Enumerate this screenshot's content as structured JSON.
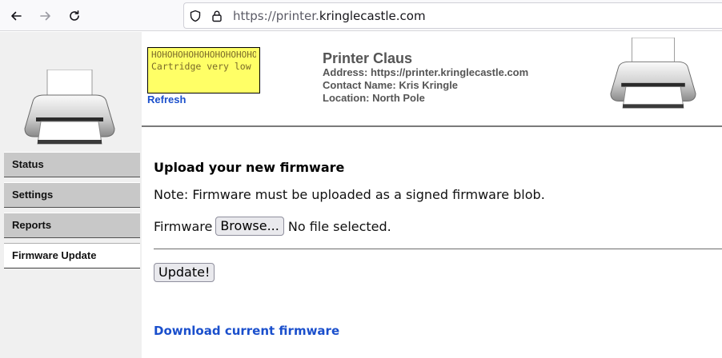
{
  "browser": {
    "url_prefix": "https://printer.",
    "url_domain": "kringlecastle.com",
    "back_icon": "arrow-left-icon",
    "forward_icon": "arrow-right-icon",
    "reload_icon": "reload-icon",
    "shield_icon": "shield-icon",
    "lock_icon": "lock-icon"
  },
  "sidebar": {
    "logo_icon": "printer-icon",
    "items": [
      {
        "label": "Status",
        "active": false
      },
      {
        "label": "Settings",
        "active": false
      },
      {
        "label": "Reports",
        "active": false
      },
      {
        "label": "Firmware Update",
        "active": true
      }
    ]
  },
  "header": {
    "alert_hoho": "HOHOHOHOHOHOHOHOHOHOH",
    "alert_message": "Cartridge very low",
    "refresh_label": "Refresh",
    "printer_name": "Printer Claus",
    "address": "Address: https://printer.kringlecastle.com",
    "contact": "Contact Name: Kris Kringle",
    "location": "Location: North Pole",
    "alert_color": "#ffff66"
  },
  "main": {
    "heading": "Upload your new firmware",
    "note": "Note: Firmware must be uploaded as a signed firmware blob.",
    "firmware_label": "Firmware",
    "browse_label": "Browse...",
    "file_status": "No file selected.",
    "update_label": "Update!",
    "download_label": "Download current firmware"
  },
  "colors": {
    "link": "#1a4fcc",
    "sidebar_bg": "#f0f0f0",
    "nav_item_bg": "#c8c8c8"
  }
}
